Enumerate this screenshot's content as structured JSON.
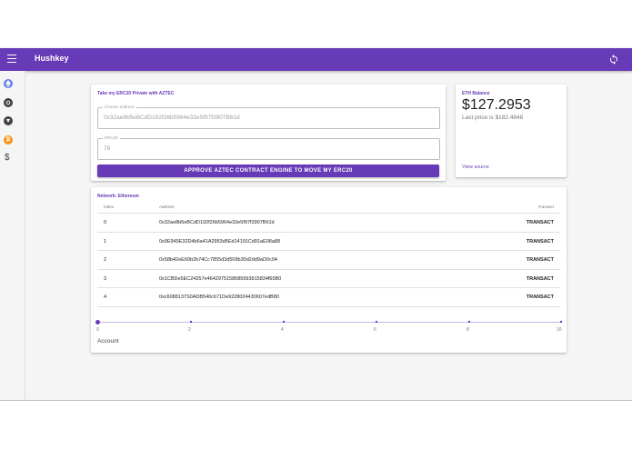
{
  "appbar": {
    "title": "Hushkey",
    "menu_icon": "menu-icon",
    "refresh_icon": "refresh-icon",
    "color": "#673ab7"
  },
  "drawer": {
    "items": [
      {
        "icon": "eth-coin-icon",
        "color": "#627eea"
      },
      {
        "icon": "dark-coin-icon",
        "color": "#424242"
      },
      {
        "icon": "dark-coin-icon-2",
        "color": "#424242"
      },
      {
        "icon": "bitcoin-coin-icon",
        "color": "#f7931a",
        "glyph": "₿"
      },
      {
        "icon": "dollar-icon",
        "glyph": "$"
      }
    ]
  },
  "private_card": {
    "title": "Take my ERC20 Private with AZTEC",
    "address_field": {
      "label": "Chosen address",
      "value": "0x32ae8b5eBCdD192f26b5964e33e5f97f3907B61d"
    },
    "amount_field": {
      "label": "ERC20",
      "value": "78"
    },
    "approve_button": "APPROVE AZTEC CONTRACT ENGINE TO MOVE MY ERC20"
  },
  "balance_card": {
    "title": "ETH Balance",
    "amount": "$127.2953",
    "last_price": "Last price is $182.4848",
    "view_source": "View source"
  },
  "accounts_card": {
    "title": "Network: Ethereum",
    "headers": {
      "index": "Index",
      "address": "Address",
      "transact": "Transact"
    },
    "rows": [
      {
        "index": "0",
        "address": "0x32ae8b5eBCdD192f26b5964e33e5f97f3907B61d",
        "action": "TRANSACT"
      },
      {
        "index": "1",
        "address": "0x9E949E32D4b6a41A2953d5Ed14191Cd91aE08a88",
        "action": "TRANSACT"
      },
      {
        "index": "2",
        "address": "0x58b42eE60b2b74Cc7855d3d509b30d2dd9aD0c04",
        "action": "TRANSACT"
      },
      {
        "index": "3",
        "address": "0x1CBDe5EC24257e4642975158685693915834f65B0",
        "action": "TRANSACT"
      },
      {
        "index": "4",
        "address": "0xc6088137S0ADB540c671De9228024430607edB80",
        "action": "TRANSACT"
      }
    ],
    "slider": {
      "value": 0,
      "min": 0,
      "max": 10,
      "tick_labels": [
        "0",
        "2",
        "4",
        "6",
        "8",
        "10"
      ],
      "label": "Account"
    }
  }
}
